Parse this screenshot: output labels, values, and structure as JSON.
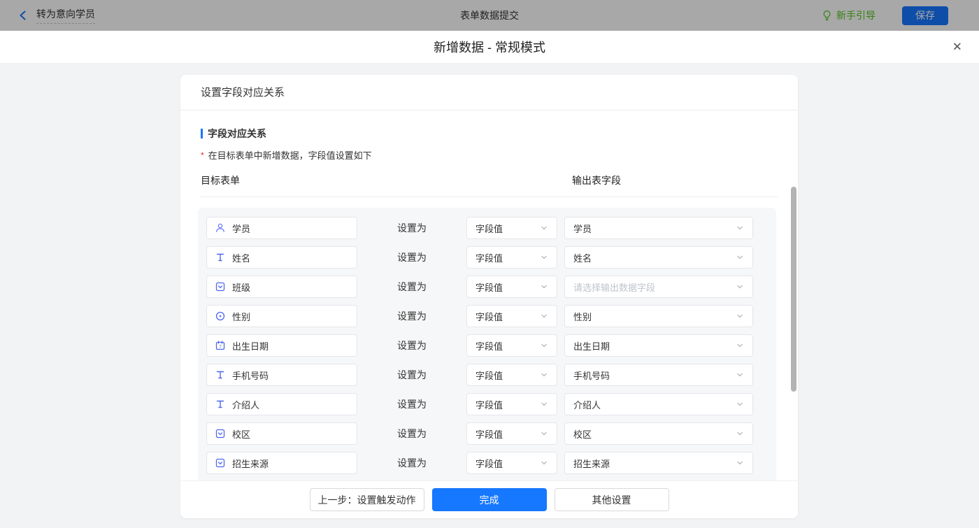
{
  "topbar": {
    "back_label": "转为意向学员",
    "title": "表单数据提交",
    "guide_label": "新手引导",
    "save_label": "保存"
  },
  "modal": {
    "title": "新增数据 - 常规模式",
    "close_icon": "✕",
    "card": {
      "header": "设置字段对应关系",
      "section_title": "字段对应关系",
      "note": "在目标表单中新增数据，字段值设置如下",
      "note_marker": "*",
      "col_left": "目标表单",
      "col_right": "输出表字段",
      "set_as_label": "设置为",
      "value_type_label": "字段值",
      "rows": [
        {
          "icon": "person-icon",
          "field": "学员",
          "output": "学员",
          "is_placeholder": false
        },
        {
          "icon": "text-icon",
          "field": "姓名",
          "output": "姓名",
          "is_placeholder": false
        },
        {
          "icon": "select-icon",
          "field": "班级",
          "output": "请选择输出数据字段",
          "is_placeholder": true
        },
        {
          "icon": "radio-icon",
          "field": "性别",
          "output": "性别",
          "is_placeholder": false
        },
        {
          "icon": "calendar-icon",
          "field": "出生日期",
          "output": "出生日期",
          "is_placeholder": false
        },
        {
          "icon": "text-icon",
          "field": "手机号码",
          "output": "手机号码",
          "is_placeholder": false
        },
        {
          "icon": "text-icon",
          "field": "介绍人",
          "output": "介绍人",
          "is_placeholder": false
        },
        {
          "icon": "select-icon",
          "field": "校区",
          "output": "校区",
          "is_placeholder": false
        },
        {
          "icon": "select-icon",
          "field": "招生来源",
          "output": "招生来源",
          "is_placeholder": false
        }
      ],
      "footer": {
        "prev_label": "上一步：设置触发动作",
        "done_label": "完成",
        "other_label": "其他设置"
      }
    }
  },
  "colors": {
    "accent": "#1677ff",
    "success": "#52c41a",
    "field_icon": "#4e68f0"
  }
}
